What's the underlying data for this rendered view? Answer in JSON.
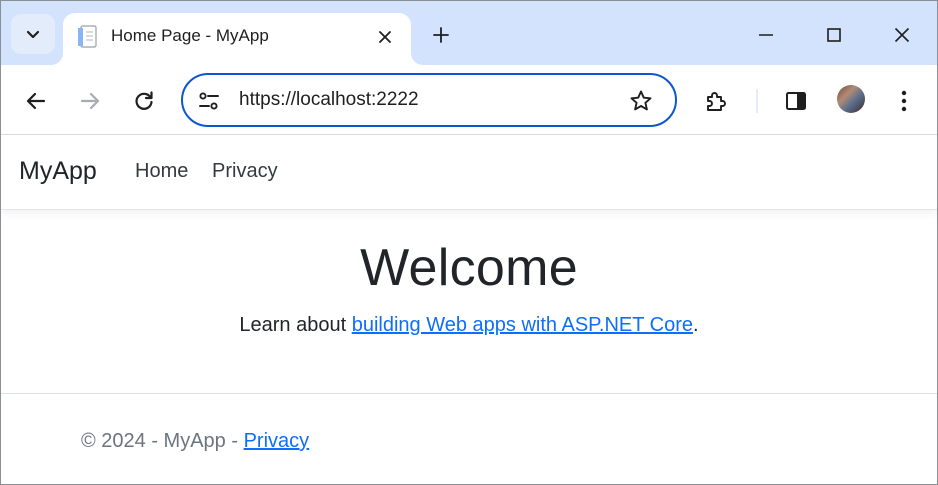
{
  "browser": {
    "tab": {
      "title": "Home Page - MyApp"
    },
    "address": {
      "url": "https://localhost:2222"
    }
  },
  "site": {
    "brand": "MyApp",
    "nav": [
      {
        "label": "Home"
      },
      {
        "label": "Privacy"
      }
    ],
    "main": {
      "heading": "Welcome",
      "lead_prefix": "Learn about ",
      "lead_link": "building Web apps with ASP.NET Core",
      "lead_suffix": "."
    },
    "footer": {
      "copyright": "© 2024 - MyApp - ",
      "privacy_link": "Privacy"
    }
  },
  "colors": {
    "tabstrip": "#d3e3fd",
    "omnibox_border": "#0b57d0",
    "link": "#0d6efd",
    "muted_text": "#6c757d"
  },
  "icons": {
    "tab_search": "chevron-down-icon",
    "favicon": "document-icon",
    "close": "close-icon",
    "new_tab": "plus-icon",
    "back": "arrow-left-icon",
    "forward": "arrow-right-icon",
    "reload": "reload-icon",
    "site_info": "tune-icon",
    "bookmark": "star-icon",
    "extensions": "puzzle-icon",
    "side_panel": "side-panel-icon",
    "menu": "kebab-menu-icon"
  }
}
